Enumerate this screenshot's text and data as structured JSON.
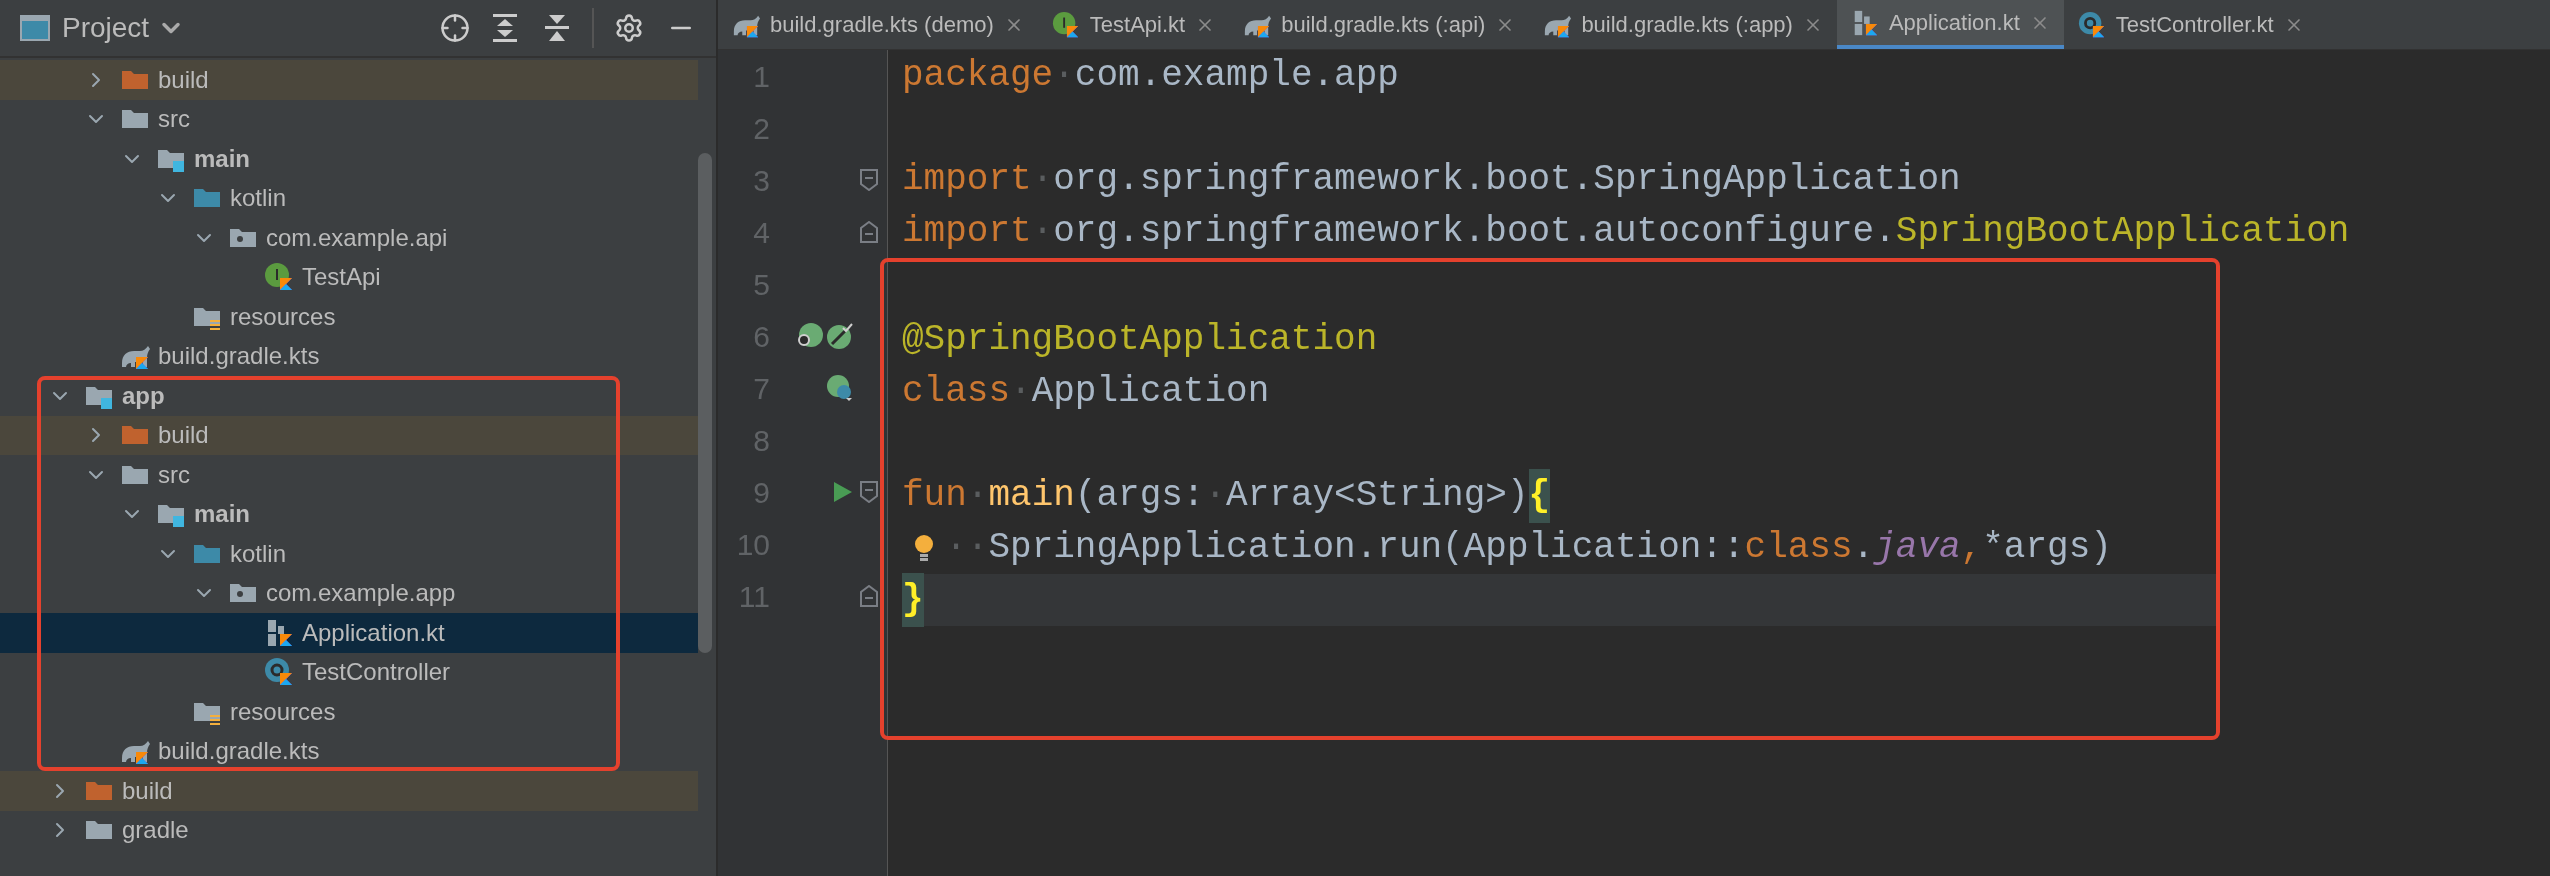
{
  "project_panel": {
    "title": "Project"
  },
  "tree": {
    "continued_children": [
      {
        "label": "build",
        "kind": "excluded",
        "expanded": false,
        "selected": false
      },
      {
        "label": "src",
        "kind": "folder",
        "expanded": true,
        "selected": false,
        "children": [
          {
            "label": "main",
            "kind": "module",
            "expanded": true,
            "selected": false,
            "children": [
              {
                "label": "kotlin",
                "kind": "source-root",
                "expanded": true,
                "selected": false,
                "children": [
                  {
                    "label": "com.example.api",
                    "kind": "package",
                    "expanded": true,
                    "selected": false,
                    "children": [
                      {
                        "label": "TestApi",
                        "kind": "kotlin-interface",
                        "selected": false
                      }
                    ]
                  }
                ]
              },
              {
                "label": "resources",
                "kind": "resources",
                "selected": false
              }
            ]
          }
        ]
      },
      {
        "label": "build.gradle.kts",
        "kind": "gradle",
        "selected": false
      }
    ],
    "nodes": [
      {
        "label": "app",
        "kind": "module",
        "expanded": true,
        "selected": false,
        "framed": true,
        "children": [
          {
            "label": "build",
            "kind": "excluded",
            "expanded": false,
            "selected": false
          },
          {
            "label": "src",
            "kind": "folder",
            "expanded": true,
            "selected": false,
            "children": [
              {
                "label": "main",
                "kind": "module",
                "expanded": true,
                "selected": false,
                "children": [
                  {
                    "label": "kotlin",
                    "kind": "source-root",
                    "expanded": true,
                    "selected": false,
                    "children": [
                      {
                        "label": "com.example.app",
                        "kind": "package",
                        "expanded": true,
                        "selected": false,
                        "children": [
                          {
                            "label": "Application.kt",
                            "kind": "kotlin-file",
                            "selected": true
                          },
                          {
                            "label": "TestController",
                            "kind": "kotlin-class",
                            "selected": false
                          }
                        ]
                      }
                    ]
                  },
                  {
                    "label": "resources",
                    "kind": "resources",
                    "selected": false
                  }
                ]
              }
            ]
          },
          {
            "label": "build.gradle.kts",
            "kind": "gradle",
            "selected": false
          }
        ]
      },
      {
        "label": "build",
        "kind": "excluded",
        "expanded": false,
        "selected": false,
        "framed": false
      },
      {
        "label": "gradle",
        "kind": "folder",
        "expanded": false,
        "selected": false,
        "framed": false
      }
    ]
  },
  "tabs": [
    {
      "label": "build.gradle.kts (demo)",
      "kind": "gradle",
      "selected": false
    },
    {
      "label": "TestApi.kt",
      "kind": "kotlin-interface",
      "selected": false
    },
    {
      "label": "build.gradle.kts (:api)",
      "kind": "gradle",
      "selected": false
    },
    {
      "label": "build.gradle.kts (:app)",
      "kind": "gradle",
      "selected": false
    },
    {
      "label": "Application.kt",
      "kind": "kotlin-file",
      "selected": true
    },
    {
      "label": "TestController.kt",
      "kind": "kotlin-class",
      "selected": false
    }
  ],
  "code": {
    "lines": [
      {
        "number": "1",
        "current": false,
        "tokens": [
          {
            "kind": "keyword",
            "text": "package"
          },
          {
            "kind": "space",
            "text": "·"
          },
          {
            "kind": "plain",
            "text": "com.example.app"
          }
        ]
      },
      {
        "number": "2",
        "current": false
      },
      {
        "number": "3",
        "current": false,
        "fold": {
          "kind": "open"
        },
        "tokens": [
          {
            "kind": "keyword",
            "text": "import"
          },
          {
            "kind": "space",
            "text": "·"
          },
          {
            "kind": "plain",
            "text": "org.springframework.boot.SpringApplication"
          }
        ]
      },
      {
        "number": "4",
        "current": false,
        "fold": {
          "kind": "close"
        },
        "tokens": [
          {
            "kind": "keyword",
            "text": "import"
          },
          {
            "kind": "space",
            "text": "·"
          },
          {
            "kind": "plain",
            "text": "org.springframework.boot.autoconfigure."
          },
          {
            "kind": "annotation",
            "text": "SpringBootApplication"
          }
        ]
      }
    ],
    "framed_lines": [
      {
        "number": "5",
        "current": false
      },
      {
        "number": "6",
        "current": false,
        "gutter": [
          {
            "kind": "spring-find"
          },
          {
            "kind": "spring-bean"
          }
        ],
        "tokens": [
          {
            "kind": "annotation",
            "text": "@SpringBootApplication"
          }
        ]
      },
      {
        "number": "7",
        "current": false,
        "gutter": [
          {
            "kind": "spring-class"
          }
        ],
        "tokens": [
          {
            "kind": "keyword",
            "text": "class"
          },
          {
            "kind": "space",
            "text": "·"
          },
          {
            "kind": "plain",
            "text": "Application"
          }
        ]
      },
      {
        "number": "8",
        "current": false
      },
      {
        "number": "9",
        "current": false,
        "gutter": [
          {
            "kind": "run"
          }
        ],
        "fold": {
          "kind": "open"
        },
        "tokens": [
          {
            "kind": "keyword",
            "text": "fun"
          },
          {
            "kind": "space",
            "text": "·"
          },
          {
            "kind": "function",
            "text": "main"
          },
          {
            "kind": "plain",
            "text": "(args:"
          },
          {
            "kind": "space",
            "text": "·"
          },
          {
            "kind": "plain",
            "text": "Array<String>)"
          },
          {
            "kind": "brace",
            "text": "{"
          }
        ]
      },
      {
        "number": "10",
        "current": false,
        "intention": true,
        "tokens": [
          {
            "kind": "space",
            "text": "··"
          },
          {
            "kind": "plain",
            "text": "SpringApplication.run(Application::"
          },
          {
            "kind": "keyword",
            "text": "class"
          },
          {
            "kind": "plain",
            "text": "."
          },
          {
            "kind": "italic",
            "text": "java"
          },
          {
            "kind": "keyword",
            "text": ","
          },
          {
            "kind": "plain",
            "text": "*args)"
          }
        ]
      },
      {
        "number": "11",
        "current": true,
        "fold": {
          "kind": "close"
        },
        "tokens": [
          {
            "kind": "brace",
            "text": "}"
          }
        ]
      }
    ]
  }
}
